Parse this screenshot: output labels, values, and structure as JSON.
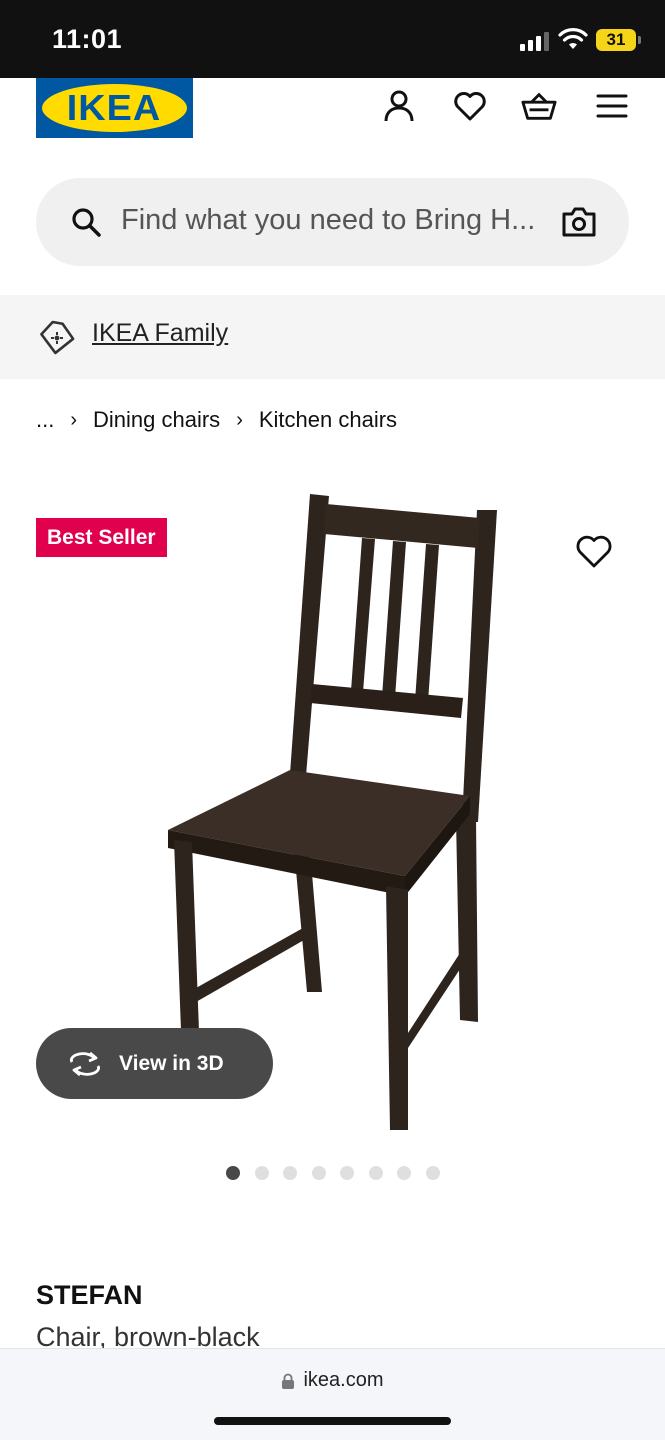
{
  "status_bar": {
    "time": "11:01",
    "battery": "31"
  },
  "header": {
    "logo_text": "IKEA",
    "icons": [
      "account-icon",
      "heart-icon",
      "basket-icon",
      "menu-icon"
    ]
  },
  "search": {
    "placeholder": "Find what you need to Bring H..."
  },
  "family": {
    "label": "IKEA Family"
  },
  "breadcrumb": {
    "ellipsis": "...",
    "items": [
      "Dining chairs",
      "Kitchen chairs"
    ],
    "separator": "›"
  },
  "product": {
    "badge": "Best Seller",
    "view_3d_label": "View in 3D",
    "image_count": 8,
    "active_image": 1,
    "name": "STEFAN",
    "description": "Chair, brown-black"
  },
  "browser": {
    "url": "ikea.com"
  },
  "colors": {
    "ikea_blue": "#0058a3",
    "ikea_yellow": "#ffdb00",
    "badge_red": "#e0004d",
    "chair_brown": "#2e241e"
  }
}
